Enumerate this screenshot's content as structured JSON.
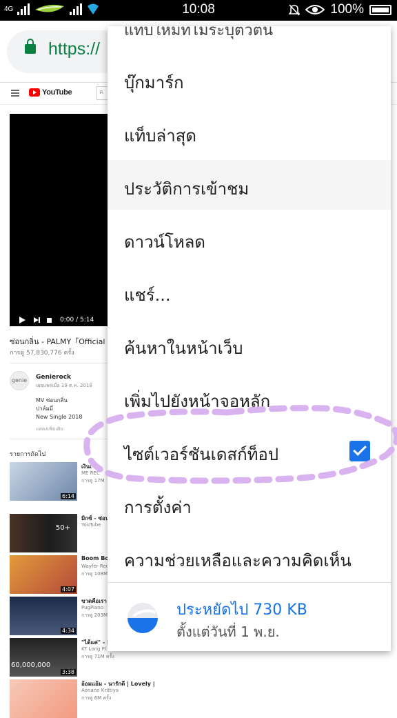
{
  "status_bar": {
    "network": "4G",
    "time": "10:08",
    "battery": "100%"
  },
  "browser": {
    "url": "https://"
  },
  "youtube": {
    "logo_text": "YouTube",
    "video_time": "0:00 / 5:14",
    "video_title": "ซ่อนกลิ่น - PALMY「Official MV",
    "video_views": "การดู 57,830,776 ครั้ง",
    "channel_avatar": "genie",
    "channel_name": "Genierock",
    "channel_date": "เผยแพร่เมื่อ 19 ต.ค. 2018",
    "description_lines": [
      "MV ซ่อนกลิ่น",
      "ปาล์มมี่",
      "New Single 2018"
    ],
    "show_more": "แสดงเพิ่มเติม",
    "up_next": "รายการถัดไป",
    "recommendations": [
      {
        "title": "เงินเ",
        "channel": "ME REC",
        "views": "การดู 17M",
        "duration": "6:14"
      },
      {
        "title": "มิกซ์ - ซ่อน",
        "channel": "YouTube",
        "views": "",
        "duration": "50+"
      },
      {
        "title": "Boom Boo",
        "channel": "Wayfer Rec",
        "views": "การดู 108M",
        "duration": "4:07"
      },
      {
        "title": "ขาดคือเรา -",
        "channel": "PugPiano",
        "views": "การดู 203M",
        "duration": "4:34"
      },
      {
        "title": "\"ได้แค่\" - K",
        "channel": "KT Long Fl",
        "views": "การดู 71M ครั้ง",
        "duration": "3:38",
        "overlay": "60,000,000"
      },
      {
        "title": "อ้อมแอ้ม - นารักดี | Lovely |",
        "channel": "Aonann Krittiya",
        "views": "การดู 6M ครั้ง",
        "duration": ""
      }
    ]
  },
  "menu": {
    "partial_top": "แท็บใหม่ที่ไม่ระบุตัวตน",
    "items": [
      {
        "label": "บุ๊กมาร์ก"
      },
      {
        "label": "แท็บล่าสุด"
      },
      {
        "label": "ประวัติการเข้าชม"
      },
      {
        "label": "ดาวน์โหลด"
      },
      {
        "label": "แชร์..."
      },
      {
        "label": "ค้นหาในหน้าเว็บ"
      },
      {
        "label": "เพิ่มไปยังหน้าจอหลัก"
      },
      {
        "label": "ไซต์เวอร์ชันเดสก์ท็อป",
        "checked": true
      },
      {
        "label": "การตั้งค่า"
      },
      {
        "label": "ความช่วยเหลือและความคิดเห็น"
      }
    ],
    "data_saver": {
      "title": "ประหยัดไป 730 KB",
      "subtitle": "ตั้งแต่วันที่ 1 พ.ย."
    }
  },
  "colors": {
    "accent": "#1a73e8",
    "secure_green": "#0b8043",
    "annotation": "#d9b3f0"
  }
}
